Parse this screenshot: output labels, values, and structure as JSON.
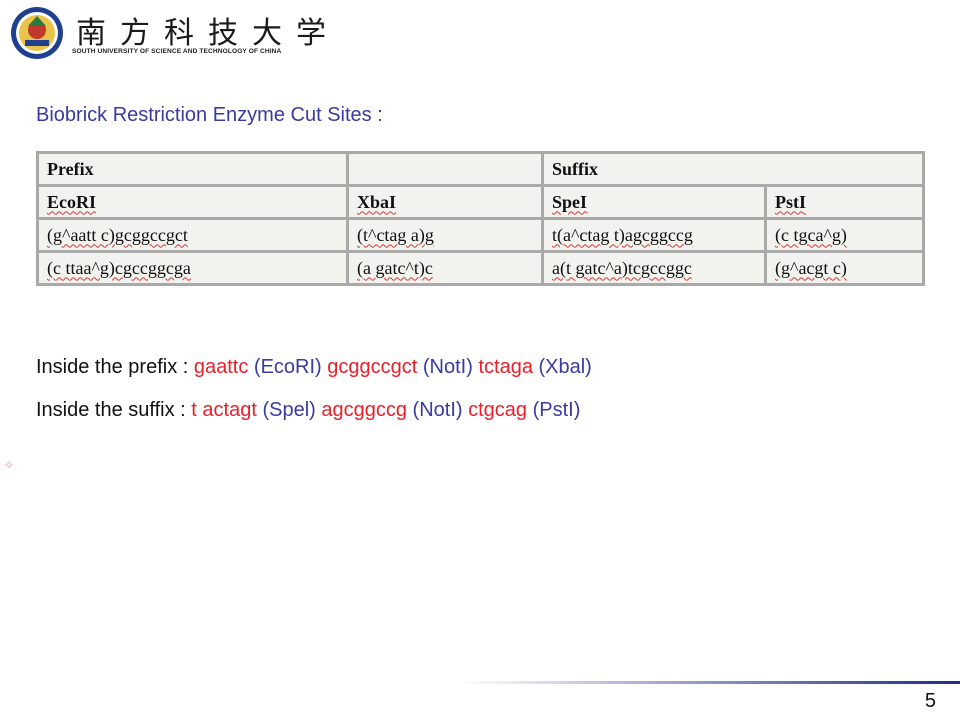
{
  "header": {
    "logo_cn": "南方科技大学",
    "logo_en": "SOUTH UNIVERSITY OF SCIENCE AND TECHNOLOGY OF CHINA"
  },
  "title": "Biobrick Restriction Enzyme Cut Sites :",
  "table": {
    "header_row": [
      "Prefix",
      "",
      "Suffix"
    ],
    "enzymes": [
      "EcoRI",
      "XbaI",
      "SpeI",
      "PstI"
    ],
    "rows": [
      [
        "(g^aatt c)gcggccgct",
        "(t^ctag a)g",
        "t(a^ctag t)agcggccg",
        "(c tgca^g)"
      ],
      [
        "(c ttaa^g)cgccggcga",
        "(a gatc^t)c",
        "a(t gatc^a)tcgccggc",
        "(g^acgt c)"
      ]
    ]
  },
  "prefix_line": {
    "label": "Inside the prefix : ",
    "seq1": "gaattc",
    "enz1": " (EcoRI) ",
    "seq2": "gcggccgct",
    "enz2": " (NotI) ",
    "seq3": "tctaga",
    "enz3": " (Xbal)"
  },
  "suffix_line": {
    "label": "Inside the suffix : ",
    "seq1": "t actagt",
    "enz1": " (Spel) ",
    "seq2": "agcggccg",
    "enz2": " (NotI) ",
    "seq3": "ctgcag",
    "enz3": " (PstI)"
  },
  "page_number": "5",
  "colors": {
    "title": "#3a3aa0",
    "sequence": "#e8202a",
    "footer_line": "#1e2a8a"
  }
}
